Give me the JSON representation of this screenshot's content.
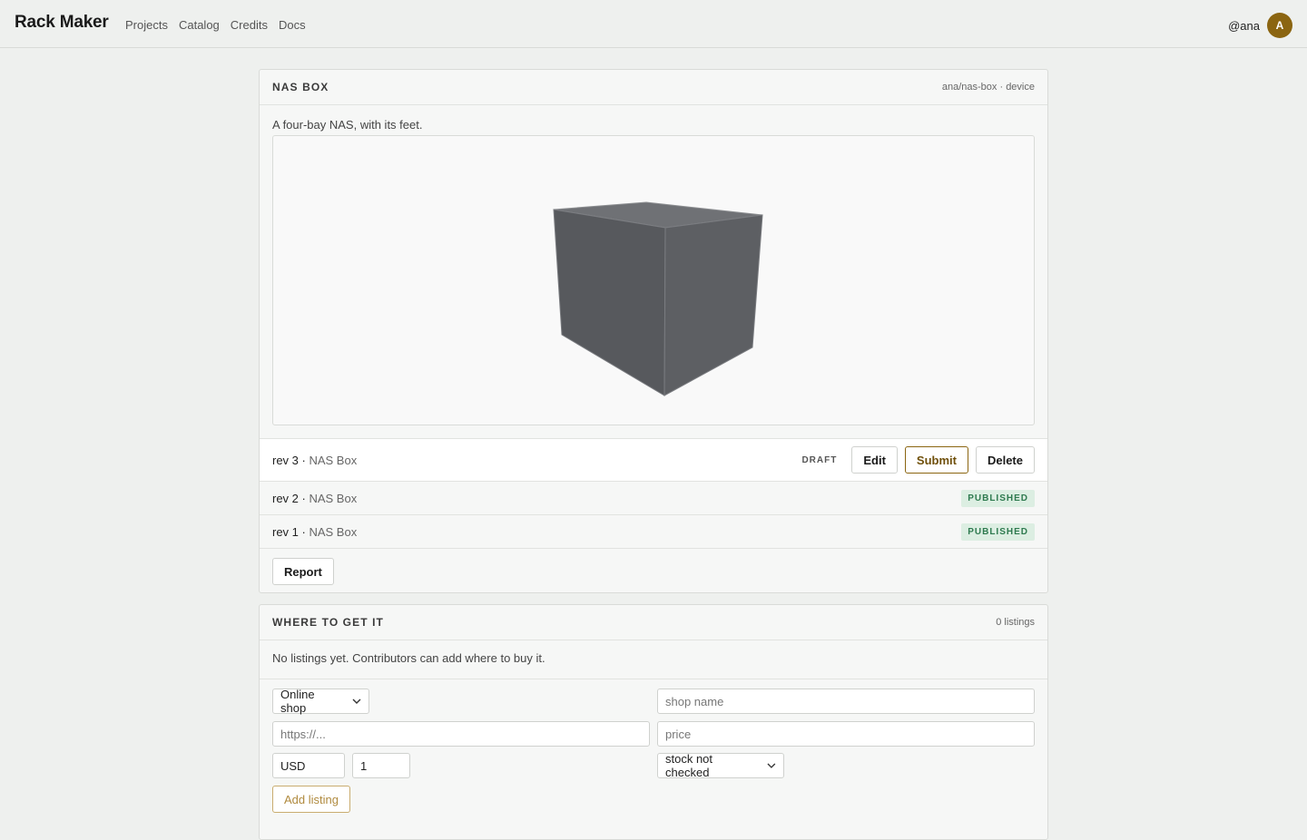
{
  "app": {
    "brand": "Rack Maker",
    "nav": [
      "Projects",
      "Catalog",
      "Credits",
      "Docs"
    ],
    "user_handle": "@ana",
    "avatar_initial": "A"
  },
  "device": {
    "title": "NAS BOX",
    "meta": "ana/nas-box · device",
    "description": "A four-bay NAS, with its feet.",
    "revisions": [
      {
        "rev": "rev 3",
        "name": "NAS Box",
        "status": "DRAFT",
        "current": true
      },
      {
        "rev": "rev 2",
        "name": "NAS Box",
        "status": "PUBLISHED",
        "current": false
      },
      {
        "rev": "rev 1",
        "name": "NAS Box",
        "status": "PUBLISHED",
        "current": false
      }
    ],
    "actions": {
      "edit": "Edit",
      "submit": "Submit",
      "delete": "Delete"
    },
    "report_label": "Report"
  },
  "listings": {
    "title": "WHERE TO GET IT",
    "count": "0 listings",
    "empty_text": "No listings yet. Contributors can add where to buy it.",
    "form": {
      "shop_type": "Online shop",
      "shop_name_placeholder": "shop name",
      "url_placeholder": "https://...",
      "price_placeholder": "price",
      "currency": "USD",
      "quantity": "1",
      "stock_status": "stock not checked",
      "add_label": "Add listing"
    }
  },
  "colors": {
    "accent": "#8b6511",
    "published_text": "#2e7a4f",
    "published_bg": "#dceee2",
    "model_face": "#57595d"
  }
}
